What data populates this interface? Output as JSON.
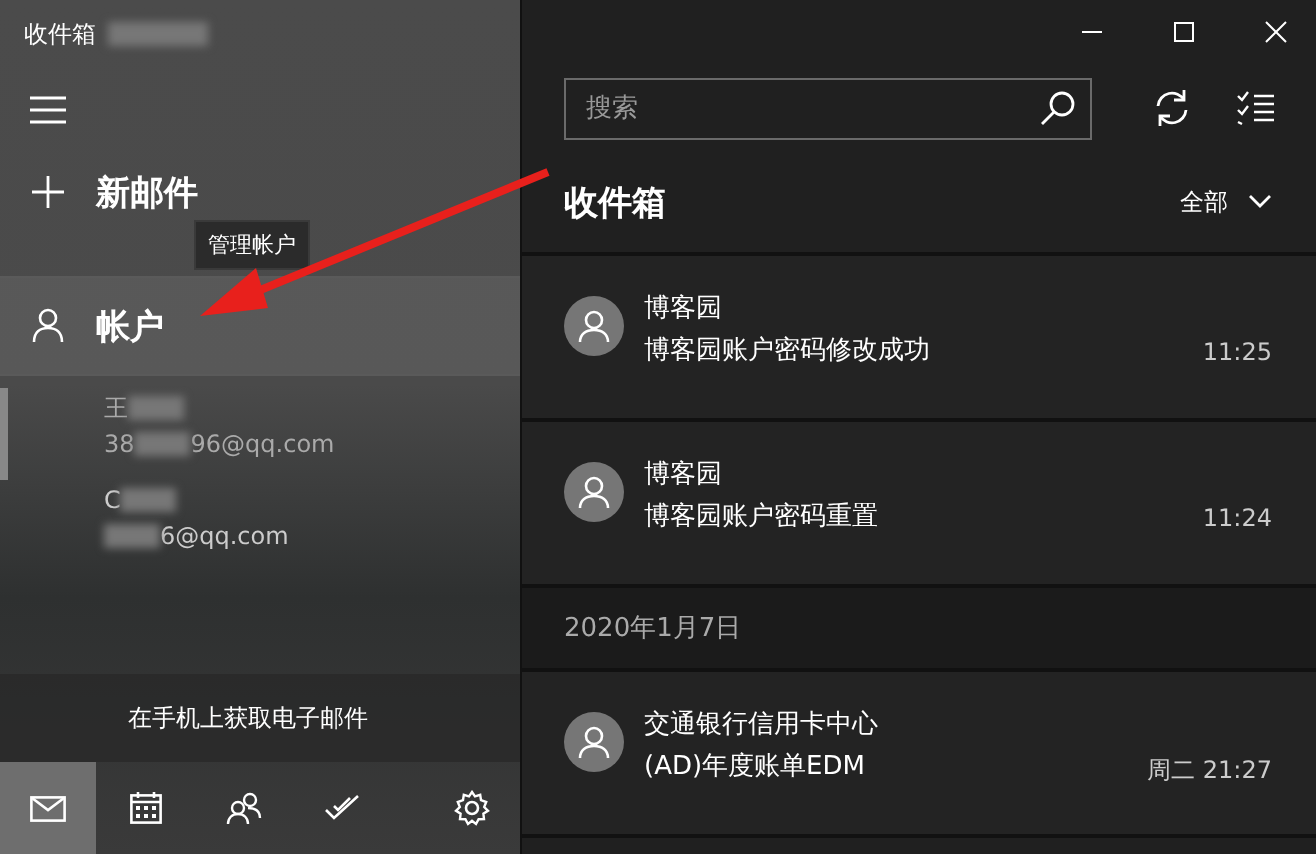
{
  "window": {
    "title": "收件箱"
  },
  "sidebar": {
    "new_mail": "新邮件",
    "accounts_label": "帐户",
    "tooltip": "管理帐户",
    "accounts": [
      {
        "name": "王",
        "email_start": "38",
        "email_end": "96@qq.com",
        "selected": true
      },
      {
        "name": "C",
        "email_end": "6@qq.com",
        "selected": false
      }
    ],
    "banner": "在手机上获取电子邮件",
    "nav": [
      {
        "kind": "mail",
        "selected": true
      },
      {
        "kind": "calendar",
        "selected": false
      },
      {
        "kind": "people",
        "selected": false
      },
      {
        "kind": "todo",
        "selected": false
      },
      {
        "kind": "settings",
        "selected": false
      }
    ]
  },
  "search": {
    "placeholder": "搜索"
  },
  "folder": {
    "title": "收件箱",
    "filter": "全部"
  },
  "messages": [
    {
      "kind": "message",
      "sender": "博客园",
      "subject": "博客园账户密码修改成功",
      "time": "11:25"
    },
    {
      "kind": "message",
      "sender": "博客园",
      "subject": "博客园账户密码重置",
      "time": "11:24"
    },
    {
      "kind": "date",
      "label": "2020年1月7日"
    },
    {
      "kind": "message",
      "sender": "交通银行信用卡中心",
      "subject": "(AD)年度账单EDM",
      "time": "周二 21:27"
    }
  ]
}
